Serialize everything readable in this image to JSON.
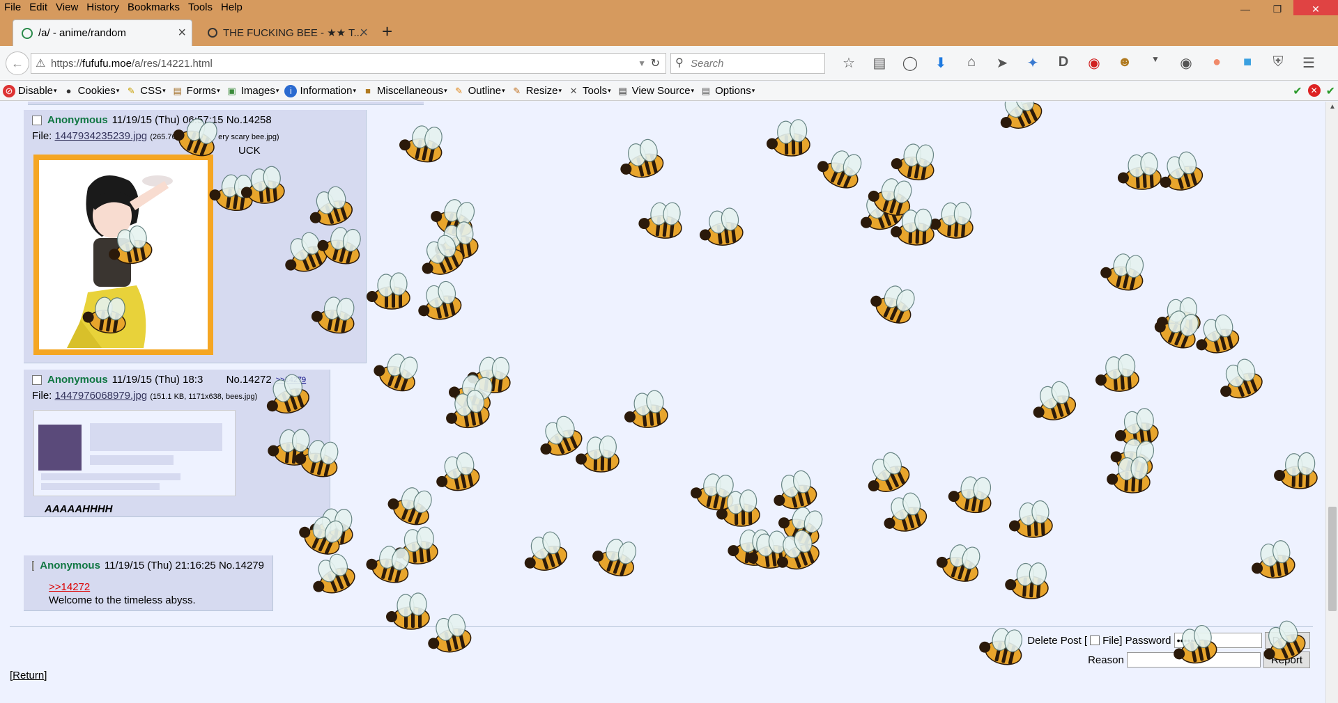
{
  "menu": [
    "File",
    "Edit",
    "View",
    "History",
    "Bookmarks",
    "Tools",
    "Help"
  ],
  "tabs": [
    {
      "title": "/a/ - anime/random",
      "active": true
    },
    {
      "title": "THE FUCKING BEE - ★★ T...",
      "active": false
    }
  ],
  "address": {
    "prefix": "https://",
    "host": "fufufu.moe",
    "path": "/a/res/14221.html"
  },
  "search_placeholder": "Search",
  "webdev": [
    "Disable",
    "Cookies",
    "CSS",
    "Forms",
    "Images",
    "Information",
    "Miscellaneous",
    "Outline",
    "Resize",
    "Tools",
    "View Source",
    "Options"
  ],
  "posts": [
    {
      "name": "Anonymous",
      "date": "11/19/15 (Thu) 06:57:15",
      "no": "No.14258",
      "file_label": "File: ",
      "filename": "1447934235239.jpg",
      "fileinfo": "(265.76 KB, 8",
      "fileinfo_tail": "ery scary bee.jpg)",
      "message": "UCK"
    },
    {
      "name": "Anonymous",
      "date": "11/19/15 (Thu) 18:3",
      "no": "No.14272",
      "quote": ">>14279",
      "file_label": "File: ",
      "filename": "1447976068979.jpg",
      "fileinfo": "(151.1 KB, 1171x638, bees.jpg)",
      "message": "AAAAAHHHH"
    },
    {
      "name": "Anonymous",
      "date": "11/19/15 (Thu) 21:16:25",
      "no": "No.14279",
      "quote": ">>14272",
      "message": "Welcome to the timeless abyss."
    }
  ],
  "delete": {
    "label_pre": "Delete Post [",
    "label_post": "File] Password",
    "password": "••••••••",
    "delete_btn": "Delete",
    "reason_label": "Reason",
    "report_btn": "Report"
  },
  "return_link": "[Return]",
  "colors": {
    "bee_body": "#e8a52c",
    "bee_stripe": "#2b1a0a",
    "bee_wing": "#e6f3f0",
    "post_bg": "#d6daf0",
    "name": "#117743"
  }
}
